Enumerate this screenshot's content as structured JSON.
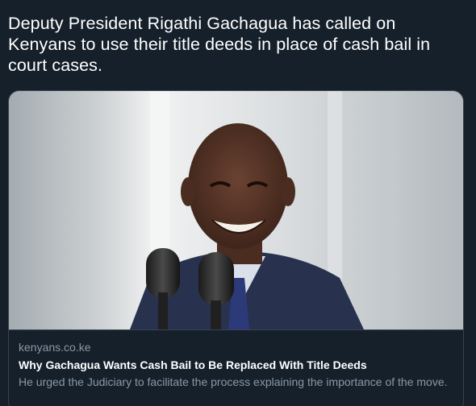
{
  "tweet": {
    "text": "Deputy President Rigathi Gachagua has called on Kenyans to use their title deeds in place of cash bail in court cases."
  },
  "card": {
    "domain": "kenyans.co.ke",
    "title": "Why Gachagua Wants Cash Bail to Be Replaced With Title Deeds",
    "description": "He urged the Judiciary to facilitate the process explaining the importance of the move."
  },
  "colors": {
    "background": "#15202b",
    "border": "#38444d",
    "text_primary": "#ffffff",
    "text_secondary": "#8b98a5"
  }
}
